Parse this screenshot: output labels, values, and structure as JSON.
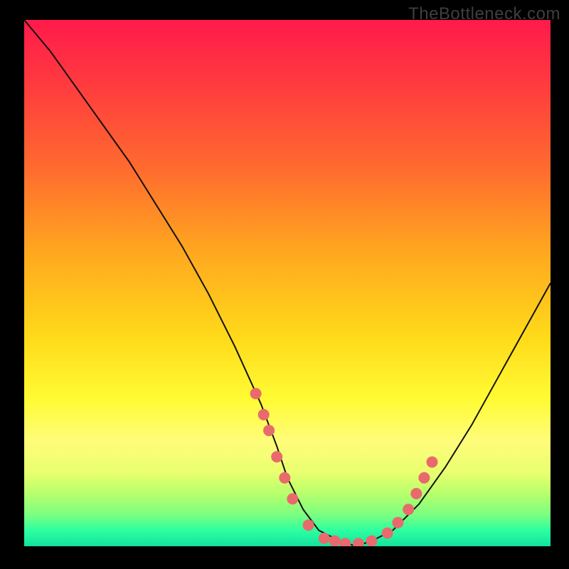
{
  "watermark": "TheBottleneck.com",
  "chart_data": {
    "type": "line",
    "title": "",
    "xlabel": "",
    "ylabel": "",
    "xlim": [
      0,
      100
    ],
    "ylim": [
      0,
      100
    ],
    "series": [
      {
        "name": "curve",
        "x": [
          0,
          5,
          10,
          15,
          20,
          25,
          30,
          35,
          40,
          45,
          48,
          50,
          53,
          56,
          60,
          63,
          66,
          70,
          75,
          80,
          85,
          90,
          95,
          100
        ],
        "y": [
          100,
          94,
          87,
          80,
          73,
          65,
          57,
          48,
          38,
          27,
          19,
          13,
          7,
          3,
          1,
          0,
          1,
          3,
          8,
          15,
          23,
          32,
          41,
          50
        ]
      }
    ],
    "markers": {
      "name": "highlighted-points",
      "color": "#e96a6c",
      "points": [
        {
          "x": 44,
          "y": 29
        },
        {
          "x": 45.5,
          "y": 25
        },
        {
          "x": 46.5,
          "y": 22
        },
        {
          "x": 48,
          "y": 17
        },
        {
          "x": 49.5,
          "y": 13
        },
        {
          "x": 51,
          "y": 9
        },
        {
          "x": 54,
          "y": 4
        },
        {
          "x": 57,
          "y": 1.5
        },
        {
          "x": 59,
          "y": 1
        },
        {
          "x": 61,
          "y": 0.5
        },
        {
          "x": 63.5,
          "y": 0.5
        },
        {
          "x": 66,
          "y": 1
        },
        {
          "x": 69,
          "y": 2.5
        },
        {
          "x": 71,
          "y": 4.5
        },
        {
          "x": 73,
          "y": 7
        },
        {
          "x": 74.5,
          "y": 10
        },
        {
          "x": 76,
          "y": 13
        },
        {
          "x": 77.5,
          "y": 16
        }
      ]
    },
    "background_gradient": {
      "direction": "vertical",
      "stops": [
        {
          "pos": 0.0,
          "color": "#ff1a4b"
        },
        {
          "pos": 0.12,
          "color": "#ff3a3f"
        },
        {
          "pos": 0.28,
          "color": "#ff6a2f"
        },
        {
          "pos": 0.44,
          "color": "#ffa71f"
        },
        {
          "pos": 0.6,
          "color": "#ffd91a"
        },
        {
          "pos": 0.72,
          "color": "#fffb33"
        },
        {
          "pos": 0.8,
          "color": "#fffc7a"
        },
        {
          "pos": 0.86,
          "color": "#e9ff6f"
        },
        {
          "pos": 0.9,
          "color": "#b7ff6c"
        },
        {
          "pos": 0.94,
          "color": "#7cff80"
        },
        {
          "pos": 0.97,
          "color": "#2dffa0"
        },
        {
          "pos": 1.0,
          "color": "#13e29e"
        }
      ]
    }
  }
}
